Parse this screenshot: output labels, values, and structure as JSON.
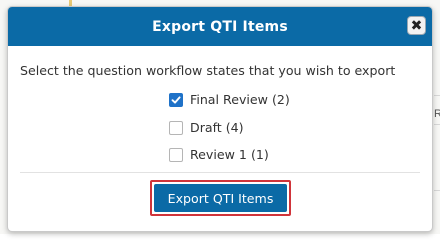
{
  "dialog": {
    "title": "Export QTI Items",
    "close_glyph": "✖",
    "prompt": "Select the question workflow states that you wish to export",
    "options": [
      {
        "label": "Final Review (2)",
        "checked": true
      },
      {
        "label": "Draft (4)",
        "checked": false
      },
      {
        "label": "Review 1 (1)",
        "checked": false
      }
    ],
    "export_label": "Export QTI Items"
  },
  "background": {
    "partial_text": "R"
  },
  "colors": {
    "header": "#0b6aa6",
    "checkbox_checked": "#1f72c8",
    "highlight_border": "#d0343a"
  },
  "icons": {
    "close": "close-icon",
    "check": "checkmark-icon"
  }
}
